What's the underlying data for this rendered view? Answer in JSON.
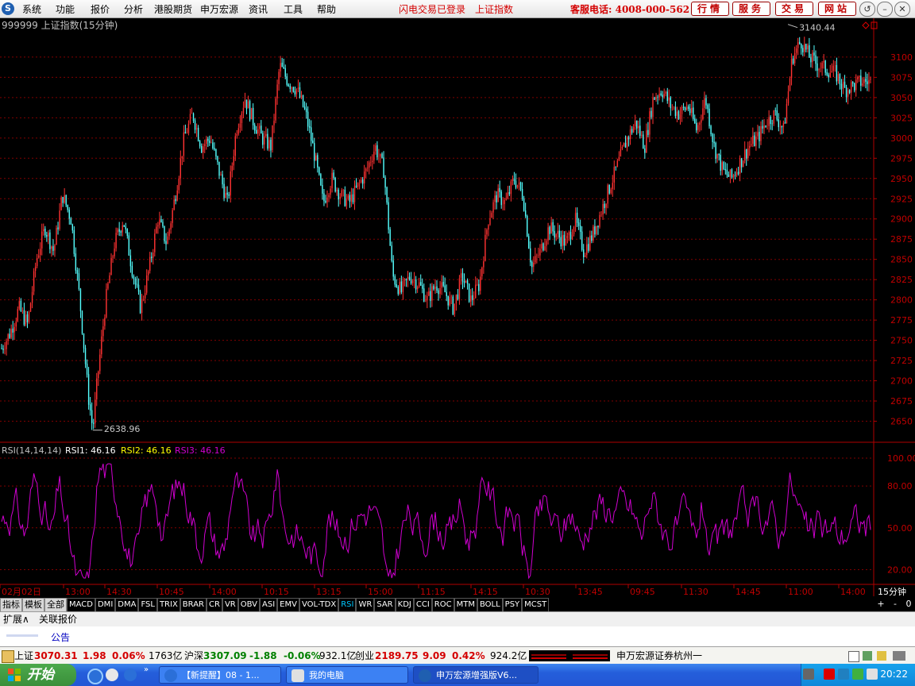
{
  "app": {
    "menu": [
      "系统",
      "功能",
      "报价",
      "分析",
      "港股期货",
      "申万宏源",
      "资讯",
      "工具",
      "帮助"
    ],
    "flash_login": "闪电交易已登录",
    "top_index": "上证指数",
    "hotline": "客服电话: 4008-000-562",
    "buttons": [
      "行情",
      "服务",
      "交易",
      "网站"
    ]
  },
  "chart_data": {
    "type": "candlestick",
    "title": "999999 上证指数(15分钟)",
    "symbol": "999999",
    "name": "上证指数",
    "period": "15分钟",
    "y_ticks": [
      2650,
      2675,
      2700,
      2725,
      2750,
      2775,
      2800,
      2825,
      2850,
      2875,
      2900,
      2925,
      2950,
      2975,
      3000,
      3025,
      3050,
      3075,
      3100
    ],
    "ylim": [
      2625,
      3148
    ],
    "high_label": "3140.44",
    "low_label": "2638.96",
    "high": 3140.44,
    "low": 2638.96,
    "x_labels": [
      "02月02日",
      "13:00",
      "14:30",
      "10:45",
      "14:00",
      "10:15",
      "13:15",
      "15:00",
      "11:15",
      "14:15",
      "10:30",
      "13:45",
      "09:45",
      "11:30",
      "14:45",
      "11:00",
      "14:00"
    ],
    "close_path": [
      [
        0,
        2740
      ],
      [
        0.01,
        2760
      ],
      [
        0.02,
        2790
      ],
      [
        0.03,
        2770
      ],
      [
        0.04,
        2850
      ],
      [
        0.05,
        2890
      ],
      [
        0.06,
        2860
      ],
      [
        0.07,
        2930
      ],
      [
        0.08,
        2900
      ],
      [
        0.09,
        2800
      ],
      [
        0.1,
        2680
      ],
      [
        0.105,
        2640
      ],
      [
        0.11,
        2700
      ],
      [
        0.12,
        2800
      ],
      [
        0.13,
        2870
      ],
      [
        0.14,
        2900
      ],
      [
        0.15,
        2840
      ],
      [
        0.16,
        2790
      ],
      [
        0.17,
        2840
      ],
      [
        0.18,
        2900
      ],
      [
        0.19,
        2870
      ],
      [
        0.2,
        2930
      ],
      [
        0.21,
        3000
      ],
      [
        0.22,
        3030
      ],
      [
        0.23,
        2990
      ],
      [
        0.24,
        3000
      ],
      [
        0.25,
        2960
      ],
      [
        0.26,
        2920
      ],
      [
        0.27,
        3010
      ],
      [
        0.28,
        3050
      ],
      [
        0.29,
        3020
      ],
      [
        0.3,
        3000
      ],
      [
        0.31,
        2990
      ],
      [
        0.32,
        3090
      ],
      [
        0.33,
        3070
      ],
      [
        0.34,
        3060
      ],
      [
        0.35,
        3030
      ],
      [
        0.36,
        2980
      ],
      [
        0.37,
        2920
      ],
      [
        0.38,
        2950
      ],
      [
        0.39,
        2930
      ],
      [
        0.4,
        2920
      ],
      [
        0.41,
        2940
      ],
      [
        0.42,
        2960
      ],
      [
        0.43,
        2990
      ],
      [
        0.44,
        2960
      ],
      [
        0.45,
        2830
      ],
      [
        0.46,
        2810
      ],
      [
        0.47,
        2830
      ],
      [
        0.48,
        2820
      ],
      [
        0.49,
        2800
      ],
      [
        0.5,
        2820
      ],
      [
        0.51,
        2810
      ],
      [
        0.52,
        2790
      ],
      [
        0.53,
        2830
      ],
      [
        0.54,
        2800
      ],
      [
        0.55,
        2820
      ],
      [
        0.56,
        2900
      ],
      [
        0.57,
        2930
      ],
      [
        0.58,
        2920
      ],
      [
        0.59,
        2950
      ],
      [
        0.6,
        2930
      ],
      [
        0.61,
        2840
      ],
      [
        0.62,
        2860
      ],
      [
        0.63,
        2890
      ],
      [
        0.64,
        2880
      ],
      [
        0.65,
        2870
      ],
      [
        0.66,
        2900
      ],
      [
        0.67,
        2860
      ],
      [
        0.68,
        2880
      ],
      [
        0.69,
        2910
      ],
      [
        0.7,
        2940
      ],
      [
        0.71,
        2970
      ],
      [
        0.72,
        3000
      ],
      [
        0.73,
        3020
      ],
      [
        0.74,
        2990
      ],
      [
        0.75,
        3050
      ],
      [
        0.76,
        3060
      ],
      [
        0.77,
        3040
      ],
      [
        0.78,
        3030
      ],
      [
        0.79,
        3040
      ],
      [
        0.8,
        3010
      ],
      [
        0.81,
        3050
      ],
      [
        0.82,
        2990
      ],
      [
        0.83,
        2960
      ],
      [
        0.84,
        2950
      ],
      [
        0.85,
        2970
      ],
      [
        0.86,
        2990
      ],
      [
        0.87,
        3000
      ],
      [
        0.88,
        3020
      ],
      [
        0.89,
        3030
      ],
      [
        0.9,
        3010
      ],
      [
        0.91,
        3100
      ],
      [
        0.92,
        3120
      ],
      [
        0.93,
        3100
      ],
      [
        0.94,
        3090
      ],
      [
        0.95,
        3085
      ],
      [
        0.96,
        3080
      ],
      [
        0.97,
        3060
      ],
      [
        0.98,
        3065
      ],
      [
        0.99,
        3070
      ],
      [
        1,
        3070
      ]
    ]
  },
  "rsi": {
    "title": "RSI(14,14,14)",
    "rsi1_label": "RSI1: 46.16",
    "rsi2_label": "RSI2: 46.16",
    "rsi3_label": "RSI3: 46.16",
    "y_ticks": [
      "100.00",
      "80.00",
      "50.00",
      "20.00"
    ],
    "y_values": [
      100,
      80,
      50,
      20
    ],
    "rsi3_color": "#d000d0"
  },
  "period_button": "15分钟",
  "tabs": [
    "指标",
    "模板",
    "全部",
    "MACD",
    "DMI",
    "DMA",
    "FSL",
    "TRIX",
    "BRAR",
    "CR",
    "VR",
    "OBV",
    "ASI",
    "EMV",
    "VOL-TDX",
    "RSI",
    "WR",
    "SAR",
    "KDJ",
    "CCI",
    "ROC",
    "MTM",
    "BOLL",
    "PSY",
    "MCST"
  ],
  "active_tab": "RSI",
  "tab_ctrls": [
    "+",
    "-",
    "0"
  ],
  "row3": [
    "扩展∧",
    "关联报价"
  ],
  "notice": "公告",
  "status": {
    "sh_label": "上证",
    "sh_value": "3070.31",
    "sh_change": "1.98",
    "sh_pct": "0.06%",
    "sh_vol": "1763亿",
    "hs_label": "沪深",
    "hs_value": "3307.09",
    "hs_change": "-1.88",
    "hs_pct": "-0.06%",
    "hs_vol": "932.1亿",
    "cy_label": "创业",
    "cy_value": "2189.75",
    "cy_change": "9.09",
    "cy_pct": "0.42%",
    "cy_vol": "924.2亿",
    "broker": "申万宏源证券杭州一"
  },
  "taskbar": {
    "start": "开始",
    "tasks": [
      "【新提醒】08 - 1...",
      "我的电脑",
      "申万宏源增强版V6..."
    ],
    "clock": "20:22"
  }
}
